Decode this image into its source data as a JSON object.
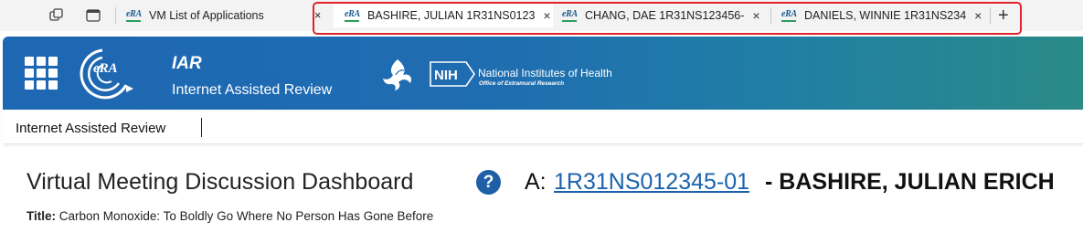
{
  "browser": {
    "tabs": [
      {
        "favicon": "eRA",
        "label": "VM List of Applications",
        "active": false
      },
      {
        "favicon": "eRA",
        "label": "BASHIRE, JULIAN 1R31NS0123",
        "active": true
      },
      {
        "favicon": "eRA",
        "label": "CHANG, DAE 1R31NS123456-",
        "active": false
      },
      {
        "favicon": "eRA",
        "label": "DANIELS, WINNIE 1R31NS234",
        "active": false
      }
    ],
    "new_tab": "+",
    "close_glyph": "×",
    "highlight_color": "#e0242a"
  },
  "header": {
    "app_abbr": "IAR",
    "app_name": "Internet Assisted Review",
    "logo_text": "eRA",
    "nih_badge": "NIH",
    "nih_name": "National Institutes of Health",
    "nih_office": "Office of Extramural Research",
    "gradient_start": "#1e67b3",
    "gradient_end": "#2b8a87"
  },
  "breadcrumb": {
    "label": "Internet Assisted Review"
  },
  "main": {
    "page_title": "Virtual Meeting Discussion Dashboard",
    "help_glyph": "?",
    "application_prefix": "A:",
    "application_number": "1R31NS012345-01",
    "separator": "-",
    "pi_name": "BASHIRE, JULIAN ERICH",
    "title_label": "Title:",
    "title_value": "Carbon Monoxide: To Boldly Go Where No Person Has Gone Before",
    "link_color": "#1b63ae"
  }
}
